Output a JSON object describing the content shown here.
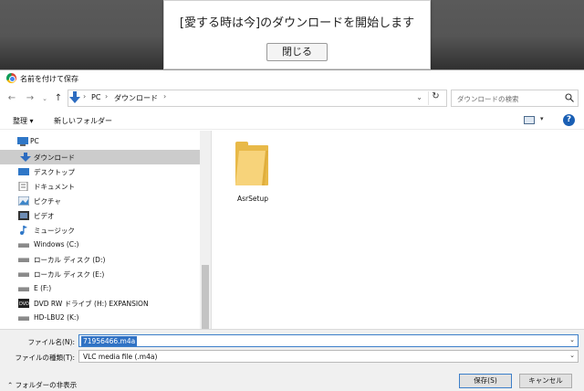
{
  "popup": {
    "message": "[愛する時は今]のダウンロードを開始します",
    "close_label": "閉じる"
  },
  "dialog": {
    "title": "名前を付けて保存"
  },
  "address": {
    "crumbs": [
      "PC",
      "ダウンロード"
    ],
    "separator": "›",
    "search_placeholder": "ダウンロードの検索"
  },
  "toolbar": {
    "organize": "整理 ▾",
    "new_folder": "新しいフォルダー"
  },
  "nav": {
    "items": [
      {
        "label": "PC",
        "icon": "pc-icon"
      },
      {
        "label": "ダウンロード",
        "icon": "download-icon",
        "selected": true
      },
      {
        "label": "デスクトップ",
        "icon": "desktop-icon"
      },
      {
        "label": "ドキュメント",
        "icon": "documents-icon"
      },
      {
        "label": "ピクチャ",
        "icon": "pictures-icon"
      },
      {
        "label": "ビデオ",
        "icon": "videos-icon"
      },
      {
        "label": "ミュージック",
        "icon": "music-icon"
      },
      {
        "label": "Windows (C:)",
        "icon": "drive-icon"
      },
      {
        "label": "ローカル ディスク (D:)",
        "icon": "drive-icon"
      },
      {
        "label": "ローカル ディスク (E:)",
        "icon": "drive-icon"
      },
      {
        "label": "E (F:)",
        "icon": "drive-icon"
      },
      {
        "label": "DVD RW ドライブ (H:) EXPANSION",
        "icon": "dvd-icon"
      },
      {
        "label": "HD-LBU2 (K:)",
        "icon": "drive-icon"
      }
    ]
  },
  "files": [
    {
      "name": "AsrSetup",
      "icon": "folder-icon"
    }
  ],
  "form": {
    "filename_label": "ファイル名(N):",
    "filename_value": "71956466.m4a",
    "filetype_label": "ファイルの種類(T):",
    "filetype_value": "VLC media file (.m4a)",
    "hide_folders": "フォルダーの非表示",
    "save_label": "保存(S)",
    "cancel_label": "キャンセル"
  },
  "colors": {
    "accent": "#3072c4",
    "selected_nav": "#cccccc",
    "folder": "#e8b948"
  }
}
